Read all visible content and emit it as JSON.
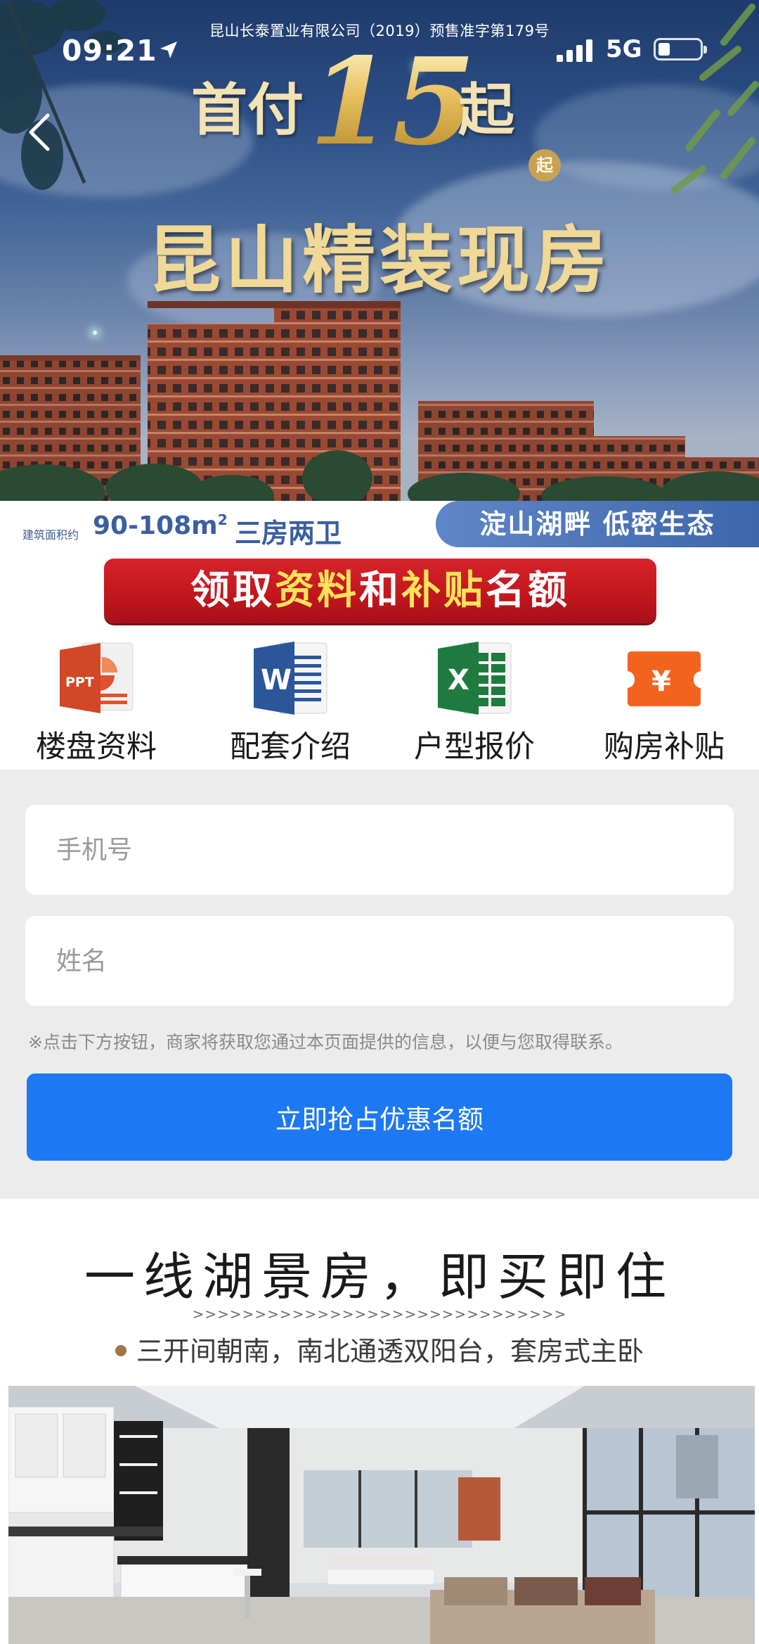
{
  "status_bar": {
    "time": "09:21",
    "network": "5G"
  },
  "hero": {
    "license": "昆山长泰置业有限公司（2019）预售准字第179号",
    "down_prefix": "首付",
    "down_number": "15",
    "down_suffix": "起",
    "down_badge": "起",
    "title": "昆山精装现房",
    "area_label": "建筑面积约",
    "area_value": "90-108m",
    "area_sup": "2",
    "rooms": "三房两卫",
    "tag": "淀山湖畔 低密生态"
  },
  "banner": {
    "part1": "领取",
    "part2": "资料",
    "part3": "和",
    "part4": "补贴",
    "part5": "名额"
  },
  "docs": [
    {
      "label": "楼盘资料",
      "icon": "ppt-icon",
      "badge": "PPT",
      "color": "#e0512e"
    },
    {
      "label": "配套介绍",
      "icon": "word-icon",
      "badge": "W",
      "color": "#2b579a"
    },
    {
      "label": "户型报价",
      "icon": "excel-icon",
      "badge": "X",
      "color": "#1f7a3f"
    },
    {
      "label": "购房补贴",
      "icon": "yuan-coupon-icon",
      "badge": "¥",
      "color": "#f2641d"
    }
  ],
  "form": {
    "phone_placeholder": "手机号",
    "name_placeholder": "姓名",
    "notice": "※点击下方按钮，商家将获取您通过本页面提供的信息，以便与您取得联系。",
    "submit_label": "立即抢占优惠名额"
  },
  "feature": {
    "title": "一线湖景房，即买即住",
    "arrows": ">>>>>>>>>>>>>>>>>>>>>>>>>>>>>>",
    "bullet": "三开间朝南，南北通透双阳台，套房式主卧"
  }
}
